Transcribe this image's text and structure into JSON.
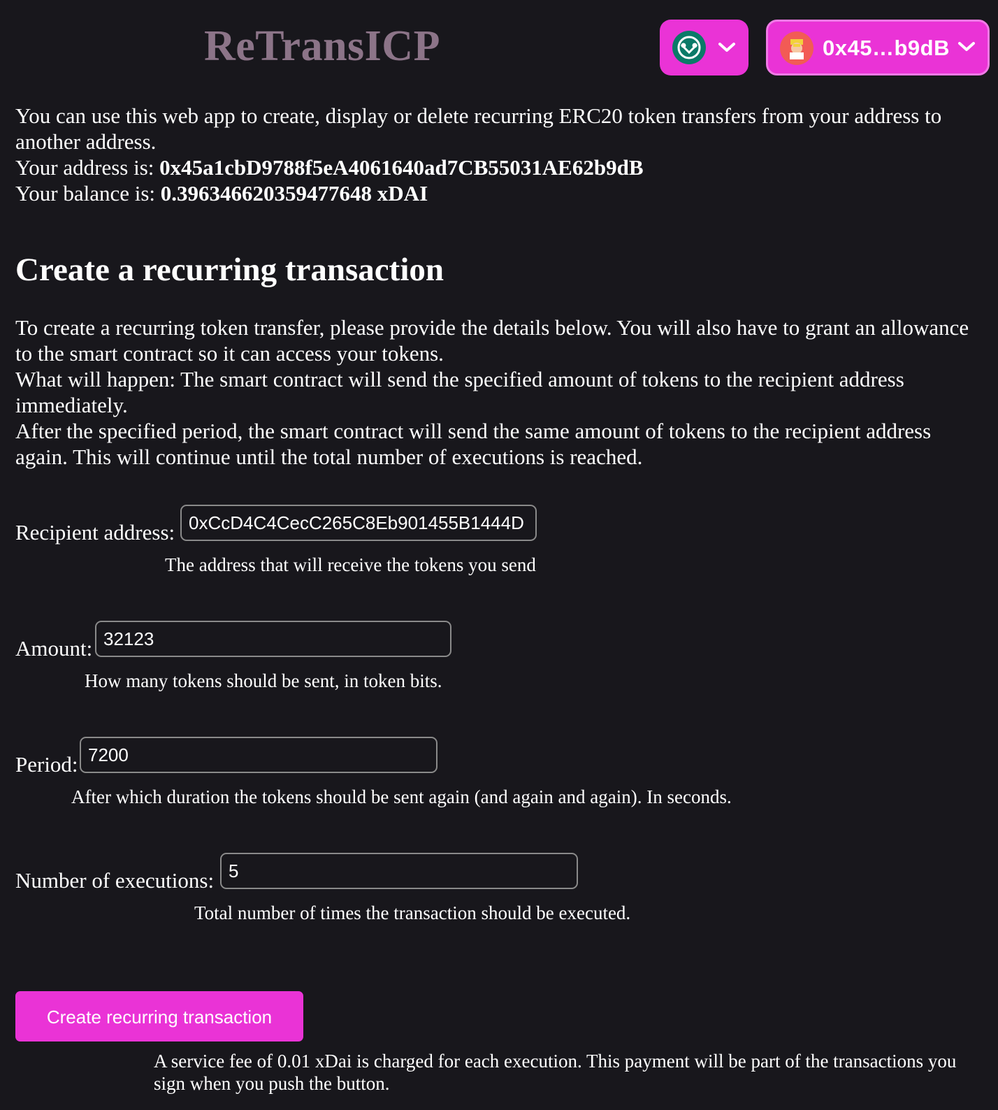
{
  "header": {
    "logo": "ReTransICP",
    "network_icon": "gnosis-chain-icon",
    "account_label": "0x45…b9dB",
    "accent": "#ea33d6"
  },
  "intro": {
    "line1": "You can use this web app to create, display or delete recurring ERC20 token transfers from your address to another address.",
    "address_prefix": "Your address is: ",
    "address": "0x45a1cbD9788f5eA4061640ad7CB55031AE62b9dB",
    "balance_prefix": "Your balance is: ",
    "balance": "0.396346620359477648 xDAI"
  },
  "create": {
    "title": "Create a recurring transaction",
    "desc1": "To create a recurring token transfer, please provide the details below. You will also have to grant an allowance to the smart contract so it can access your tokens.",
    "desc2": "What will happen: The smart contract will send the specified amount of tokens to the recipient address immediately.",
    "desc3": "After the specified period, the smart contract will send the same amount of tokens to the recipient address again. This will continue until the total number of executions is reached."
  },
  "form": {
    "recipient": {
      "label": "Recipient address:",
      "value": "0xCcD4C4CecC265C8Eb901455B1444D",
      "hint": "The address that will receive the tokens you send"
    },
    "amount": {
      "label": "Amount:",
      "value": "32123",
      "hint": "How many tokens should be sent, in token bits."
    },
    "period": {
      "label": "Period:",
      "value": "7200",
      "hint": "After which duration the tokens should be sent again (and again and again). In seconds."
    },
    "executions": {
      "label": "Number of executions:",
      "value": "5",
      "hint": "Total number of times the transaction should be executed."
    },
    "submit_label": "Create recurring transaction",
    "fee_note": "A service fee of 0.01 xDai is charged for each execution. This payment will be part of the transactions you sign when you push the button."
  }
}
